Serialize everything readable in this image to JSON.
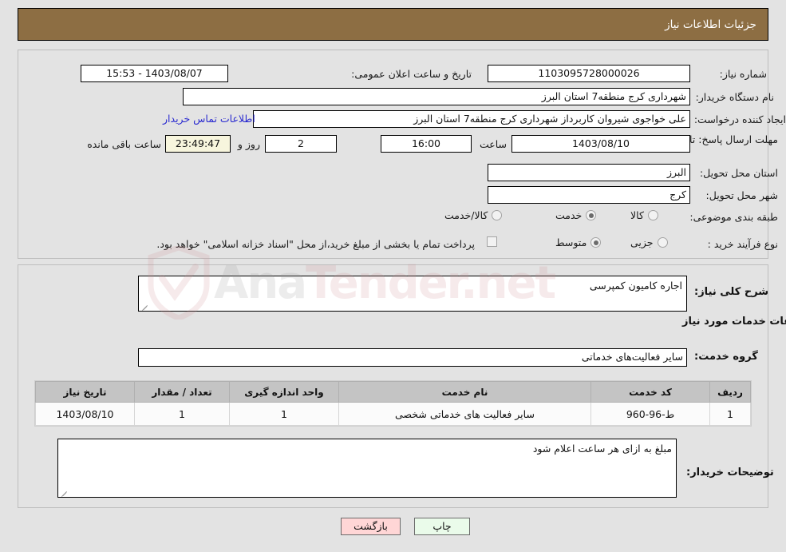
{
  "header": {
    "title": "جزئیات اطلاعات نیاز"
  },
  "watermark": {
    "text_left": "Ana",
    "text_right": "Tender.net",
    "icon": "shield-icon"
  },
  "need_info": {
    "need_number_label": "شماره نیاز:",
    "need_number_value": "1103095728000026",
    "announce_datetime_label": "تاریخ و ساعت اعلان عمومی:",
    "announce_datetime_value": "1403/08/07 - 15:53",
    "buyer_org_label": "نام دستگاه خریدار:",
    "buyer_org_value": "شهرداری کرج منطقه7 استان البرز",
    "requester_label": "ایجاد کننده درخواست:",
    "requester_value": "علی خواجوی شیروان کاربرداز شهرداری کرج منطقه7 استان البرز",
    "contact_link": "اطلاعات تماس خریدار",
    "deadline_label": "مهلت ارسال پاسخ: تا تاریخ:",
    "deadline_date": "1403/08/10",
    "deadline_time_label": "ساعت",
    "deadline_time": "16:00",
    "remaining_days": "2",
    "remaining_days_label": "روز و",
    "remaining_clock": "23:49:47",
    "remaining_suffix": "ساعت باقی مانده",
    "province_label": "استان محل تحویل:",
    "province_value": "البرز",
    "city_label": "شهر محل تحویل:",
    "city_value": "کرج",
    "category_label": "طبقه بندی موضوعی:",
    "category_options": [
      {
        "label": "کالا",
        "selected": false
      },
      {
        "label": "خدمت",
        "selected": true
      },
      {
        "label": "کالا/خدمت",
        "selected": false
      }
    ],
    "process_label": "نوع فرآیند خرید :",
    "process_options": [
      {
        "label": "جزیی",
        "selected": false
      },
      {
        "label": "متوسط",
        "selected": true
      }
    ],
    "treasury_checkbox_checked": false,
    "treasury_note": "پرداخت تمام یا بخشی از مبلغ خرید،از محل \"اسناد خزانه اسلامی\" خواهد بود."
  },
  "summary": {
    "need_summary_label": "شرح کلی نیاز:",
    "need_summary_value": "اجاره کامیون کمپرسی",
    "services_section_title": "اطلاعات خدمات مورد نیاز",
    "service_group_label": "گروه خدمت:",
    "service_group_value": "سایر فعالیت‌های خدماتی"
  },
  "services_table": {
    "columns": [
      "ردیف",
      "کد خدمت",
      "نام خدمت",
      "واحد اندازه گیری",
      "تعداد / مقدار",
      "تاریخ نیاز"
    ],
    "rows": [
      {
        "row_no": "1",
        "service_code": "ط-96-960",
        "service_name": "سایر فعالیت های خدماتی شخصی",
        "unit": "1",
        "quantity": "1",
        "need_date": "1403/08/10"
      }
    ]
  },
  "buyer_notes": {
    "label": "توضیحات خریدار:",
    "value": "مبلغ به ازای هر ساعت اعلام شود"
  },
  "footer": {
    "print_label": "چاپ",
    "back_label": "بازگشت"
  }
}
